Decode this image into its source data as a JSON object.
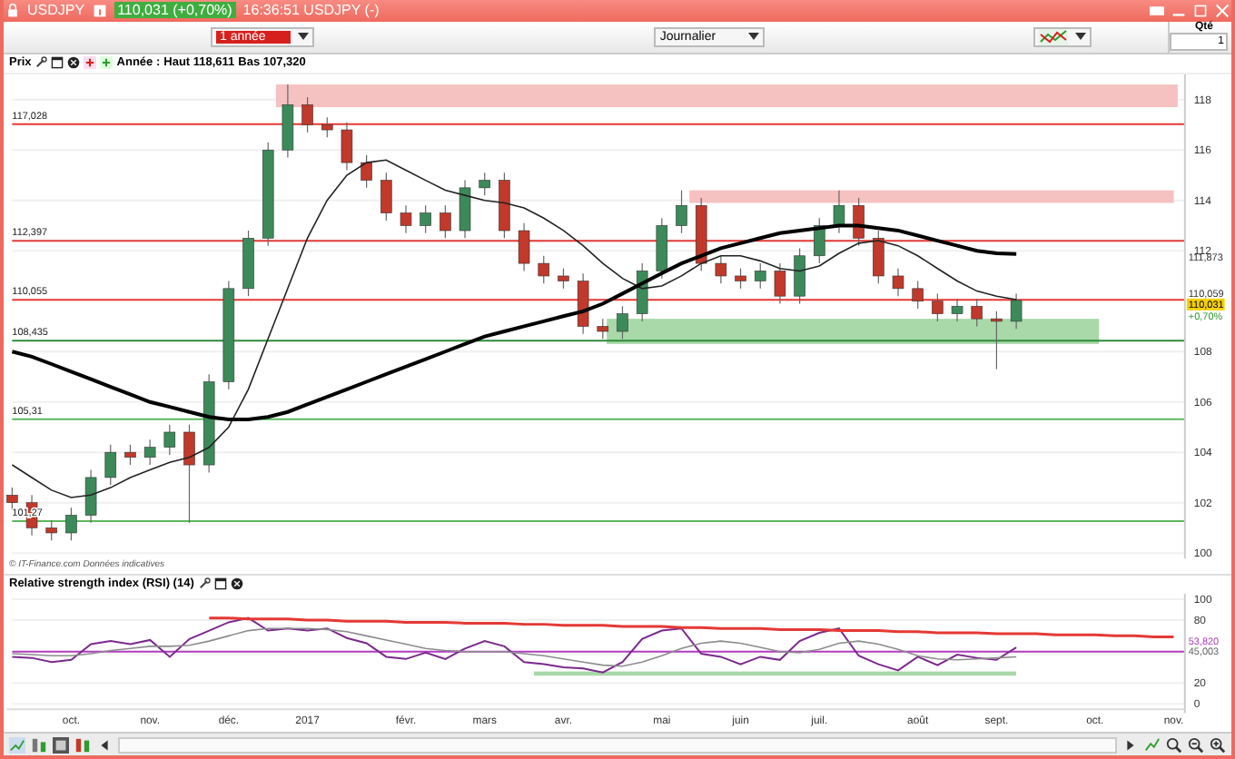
{
  "window": {
    "title": "USDJPY",
    "quote": "110,031 (+0,70%)",
    "time_title": "16:36:51 USDJPY (-)"
  },
  "toolbar": {
    "period": "1 année",
    "interval": "Journalier",
    "quantity_label": "Qté",
    "quantity": "1"
  },
  "price_header": {
    "label": "Prix",
    "period_label": "Année :",
    "high": "Haut 118,611",
    "low": "Bas 107,320"
  },
  "price_chart": {
    "chart_data": {
      "type": "candlestick",
      "categories": [
        null,
        null,
        null,
        null,
        null,
        null,
        null,
        null,
        null,
        null,
        null,
        null,
        null,
        null,
        null,
        null,
        null,
        null,
        null,
        null,
        null,
        null,
        null,
        null,
        null,
        null,
        null,
        null,
        null,
        null,
        null,
        null,
        null,
        null,
        null,
        null,
        null,
        null,
        null,
        null,
        null,
        null,
        null,
        null,
        null,
        null,
        null,
        null,
        null,
        null,
        null,
        null,
        null,
        null,
        null,
        null,
        null,
        null,
        null,
        null
      ],
      "grid": true,
      "ylim": [
        99.8,
        119
      ],
      "yticks": [
        100,
        102,
        104,
        106,
        108,
        112,
        114,
        116,
        118
      ],
      "ohlc": [
        [
          102.3,
          102.6,
          101.7,
          102.0
        ],
        [
          102.0,
          102.3,
          100.7,
          101.0
        ],
        [
          101.0,
          101.3,
          100.5,
          100.8
        ],
        [
          100.8,
          101.8,
          100.5,
          101.5
        ],
        [
          101.5,
          103.3,
          101.2,
          103.0
        ],
        [
          103.0,
          104.3,
          102.7,
          104.0
        ],
        [
          104.0,
          104.3,
          103.5,
          103.8
        ],
        [
          103.8,
          104.5,
          103.5,
          104.2
        ],
        [
          104.2,
          105.1,
          103.9,
          104.8
        ],
        [
          104.8,
          105.1,
          101.2,
          103.5
        ],
        [
          103.5,
          107.1,
          103.2,
          106.8
        ],
        [
          106.8,
          110.8,
          106.5,
          110.5
        ],
        [
          110.5,
          112.8,
          110.2,
          112.5
        ],
        [
          112.5,
          116.3,
          112.2,
          116.0
        ],
        [
          116.0,
          118.6,
          115.7,
          117.8
        ],
        [
          117.8,
          118.1,
          116.7,
          117.0
        ],
        [
          117.0,
          117.3,
          116.5,
          116.8
        ],
        [
          116.8,
          117.1,
          115.2,
          115.5
        ],
        [
          115.5,
          115.8,
          114.5,
          114.8
        ],
        [
          114.8,
          115.1,
          113.2,
          113.5
        ],
        [
          113.5,
          113.8,
          112.7,
          113.0
        ],
        [
          113.0,
          113.8,
          112.7,
          113.5
        ],
        [
          113.5,
          113.8,
          112.5,
          112.8
        ],
        [
          112.8,
          114.8,
          112.5,
          114.5
        ],
        [
          114.5,
          115.1,
          114.2,
          114.8
        ],
        [
          114.8,
          115.1,
          112.5,
          112.8
        ],
        [
          112.8,
          113.1,
          111.2,
          111.5
        ],
        [
          111.5,
          111.8,
          110.7,
          111.0
        ],
        [
          111.0,
          111.3,
          110.5,
          110.8
        ],
        [
          110.8,
          111.1,
          108.7,
          109.0
        ],
        [
          109.0,
          109.3,
          108.5,
          108.8
        ],
        [
          108.8,
          109.8,
          108.5,
          109.5
        ],
        [
          109.5,
          111.5,
          109.2,
          111.2
        ],
        [
          111.2,
          113.3,
          110.9,
          113.0
        ],
        [
          113.0,
          114.4,
          112.7,
          113.8
        ],
        [
          113.8,
          114.1,
          111.2,
          111.5
        ],
        [
          111.5,
          111.8,
          110.7,
          111.0
        ],
        [
          111.0,
          111.3,
          110.5,
          110.8
        ],
        [
          110.8,
          111.5,
          110.5,
          111.2
        ],
        [
          111.2,
          111.5,
          109.9,
          110.2
        ],
        [
          110.2,
          112.1,
          109.9,
          111.8
        ],
        [
          111.8,
          113.3,
          111.5,
          113.0
        ],
        [
          113.0,
          114.4,
          112.7,
          113.8
        ],
        [
          113.8,
          114.1,
          112.2,
          112.5
        ],
        [
          112.5,
          112.8,
          110.7,
          111.0
        ],
        [
          111.0,
          111.3,
          110.2,
          110.5
        ],
        [
          110.5,
          110.8,
          109.7,
          110.0
        ],
        [
          110.0,
          110.3,
          109.2,
          109.5
        ],
        [
          109.5,
          110.1,
          109.2,
          109.8
        ],
        [
          109.8,
          110.1,
          109.0,
          109.3
        ],
        [
          109.3,
          109.6,
          107.3,
          109.2
        ],
        [
          109.2,
          110.3,
          108.9,
          110.03
        ],
        null,
        null,
        null,
        null,
        null,
        null,
        null,
        null
      ],
      "series": [
        {
          "type": "line",
          "color": "#222222",
          "values": [
            103.5,
            103.0,
            102.5,
            102.2,
            102.3,
            102.6,
            103.0,
            103.3,
            103.6,
            103.8,
            104.2,
            105.0,
            106.5,
            108.5,
            110.5,
            112.5,
            114.0,
            115.0,
            115.5,
            115.6,
            115.2,
            114.8,
            114.4,
            114.2,
            114.0,
            113.9,
            113.7,
            113.3,
            112.8,
            112.2,
            111.5,
            110.9,
            110.5,
            110.6,
            111.0,
            111.5,
            111.8,
            111.8,
            111.6,
            111.3,
            111.2,
            111.4,
            111.9,
            112.3,
            112.4,
            112.2,
            111.8,
            111.3,
            110.8,
            110.4,
            110.2,
            110.06,
            null,
            null,
            null,
            null,
            null,
            null,
            null,
            null
          ]
        },
        {
          "type": "line",
          "color": "#000000",
          "values": [
            108.0,
            107.8,
            107.5,
            107.2,
            106.9,
            106.6,
            106.3,
            106.0,
            105.8,
            105.6,
            105.4,
            105.3,
            105.3,
            105.4,
            105.6,
            105.9,
            106.2,
            106.5,
            106.8,
            107.1,
            107.4,
            107.7,
            108.0,
            108.3,
            108.6,
            108.8,
            109.0,
            109.2,
            109.4,
            109.6,
            109.9,
            110.3,
            110.7,
            111.1,
            111.5,
            111.8,
            112.1,
            112.3,
            112.5,
            112.7,
            112.8,
            112.9,
            113.0,
            113.0,
            112.9,
            112.8,
            112.6,
            112.4,
            112.2,
            112.0,
            111.9,
            111.87,
            null,
            null,
            null,
            null,
            null,
            null,
            null,
            null
          ]
        }
      ],
      "bands": [
        {
          "axis": "y",
          "from": 117.7,
          "to": 118.6,
          "color": "#f6c1c1"
        },
        {
          "axis": "y",
          "from": 113.9,
          "to": 114.4,
          "color": "#f6c1c1"
        },
        {
          "axis": "y",
          "from": 108.3,
          "to": 109.3,
          "color": "#a9d8a9"
        }
      ],
      "ref_lines": [
        {
          "axis": "y",
          "value": 117.028,
          "label": "117,028",
          "color": "#e53935"
        },
        {
          "axis": "y",
          "value": 112.397,
          "label": "112,397",
          "color": "#e53935"
        },
        {
          "axis": "y",
          "value": 110.055,
          "label": "110,055",
          "color": "#e53935"
        },
        {
          "axis": "y",
          "value": 108.435,
          "label": "108,435",
          "color": "#2e8b3a"
        },
        {
          "axis": "y",
          "value": 105.31,
          "label": "105,31",
          "color": "#5cb85c"
        },
        {
          "axis": "y",
          "value": 101.27,
          "label": "101,27",
          "color": "#5cb85c"
        }
      ]
    },
    "markers": [
      {
        "kind": "ma",
        "text": "111,873"
      },
      {
        "kind": "level",
        "text": "110,059"
      },
      {
        "kind": "last",
        "text": "110,031"
      },
      {
        "kind": "change",
        "text": "+0,70%"
      }
    ]
  },
  "copyright": "© IT-Finance.com Données indicatives",
  "rsi_header": "Relative strength index (RSI) (14)",
  "rsi_chart": {
    "chart_data": {
      "type": "line",
      "categories": [
        null,
        null,
        null,
        "oct.",
        null,
        null,
        null,
        "nov.",
        null,
        null,
        null,
        "déc.",
        null,
        null,
        null,
        "2017",
        null,
        null,
        null,
        null,
        "févr.",
        null,
        null,
        null,
        "mars",
        null,
        null,
        null,
        "avr.",
        null,
        null,
        null,
        null,
        "mai",
        null,
        null,
        null,
        "juin",
        null,
        null,
        null,
        "juil.",
        null,
        null,
        null,
        null,
        "août",
        null,
        null,
        null,
        "sept.",
        null,
        null,
        null,
        null,
        "oct.",
        null,
        null,
        null,
        "nov."
      ],
      "grid": true,
      "ylim": [
        0,
        100
      ],
      "yticks": [
        0,
        20,
        80,
        100
      ],
      "series": [
        {
          "color": "#7b2a8c",
          "values": [
            45,
            44,
            40,
            42,
            57,
            60,
            57,
            61,
            45,
            62,
            70,
            78,
            82,
            70,
            72,
            70,
            72,
            63,
            58,
            45,
            43,
            49,
            43,
            53,
            60,
            55,
            40,
            38,
            35,
            34,
            30,
            40,
            62,
            70,
            72,
            48,
            45,
            38,
            45,
            42,
            60,
            68,
            72,
            46,
            38,
            32,
            45,
            37,
            47,
            44,
            42,
            54,
            null,
            null,
            null,
            null,
            null,
            null,
            null,
            null
          ]
        },
        {
          "color": "#8c8c8c",
          "values": [
            48,
            47,
            46,
            46,
            48,
            51,
            53,
            55,
            55,
            56,
            60,
            65,
            70,
            72,
            72,
            72,
            71,
            69,
            65,
            61,
            57,
            53,
            51,
            50,
            50,
            50,
            48,
            46,
            43,
            40,
            37,
            36,
            40,
            46,
            53,
            58,
            60,
            58,
            54,
            50,
            49,
            52,
            58,
            60,
            57,
            52,
            46,
            43,
            42,
            43,
            44,
            45,
            null,
            null,
            null,
            null,
            null,
            null,
            null,
            null
          ]
        },
        {
          "color": "#e53935",
          "values": [
            null,
            null,
            null,
            null,
            null,
            null,
            null,
            null,
            null,
            null,
            82,
            82,
            81,
            81,
            81,
            80,
            80,
            79,
            79,
            79,
            78,
            78,
            78,
            77,
            77,
            77,
            76,
            76,
            75,
            75,
            75,
            74,
            74,
            74,
            73,
            73,
            72,
            72,
            72,
            71,
            71,
            71,
            70,
            70,
            70,
            69,
            69,
            68,
            68,
            68,
            67,
            67,
            67,
            66,
            66,
            66,
            65,
            65,
            64,
            64
          ]
        }
      ],
      "bands": [
        {
          "axis": "y",
          "from": 27,
          "to": 31,
          "color": "#a9d8a9"
        }
      ],
      "ref_lines": [
        {
          "axis": "y",
          "value": 50,
          "color": "#b03cc0"
        }
      ]
    },
    "markers": [
      {
        "kind": "value",
        "text": "53,820"
      },
      {
        "kind": "signal",
        "text": "45,003"
      }
    ]
  }
}
